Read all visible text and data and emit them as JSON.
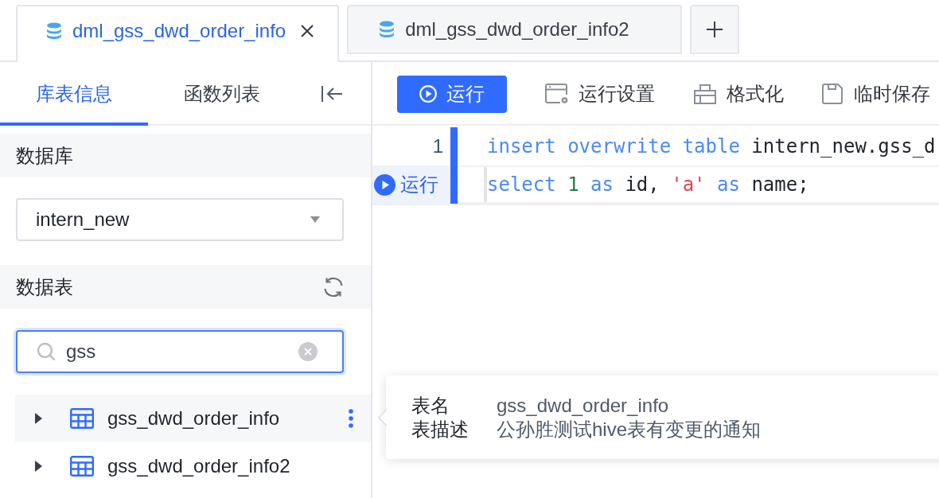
{
  "file_tabs": [
    {
      "label": "dml_gss_dwd_order_info",
      "selected": true
    },
    {
      "label": "dml_gss_dwd_order_info2",
      "selected": false
    }
  ],
  "sidebar": {
    "tabs": [
      {
        "label": "库表信息",
        "selected": true
      },
      {
        "label": "函数列表",
        "selected": false
      }
    ],
    "database": {
      "title": "数据库",
      "value": "intern_new"
    },
    "tables": {
      "title": "数据表",
      "search": {
        "value": "gss"
      },
      "items": [
        {
          "label": "gss_dwd_order_info",
          "selected": true,
          "expanded": false
        },
        {
          "label": "gss_dwd_order_info2",
          "selected": false,
          "expanded": false
        }
      ]
    }
  },
  "toolbar": {
    "buttons": [
      {
        "kind": "run",
        "label": "运行"
      },
      {
        "kind": "settings",
        "label": "运行设置"
      },
      {
        "kind": "format",
        "label": "格式化"
      },
      {
        "kind": "save",
        "label": "临时保存"
      }
    ]
  },
  "editor": {
    "lines": [
      {
        "gutter": {
          "kind": "number",
          "text": "1"
        },
        "current": false,
        "tokens": [
          {
            "kind": "keyword",
            "text": "insert overwrite table"
          },
          {
            "kind": "plain",
            "text": " intern_new.gss_d"
          }
        ]
      },
      {
        "gutter": {
          "kind": "run",
          "text": "运行"
        },
        "current": true,
        "tokens": [
          {
            "kind": "keyword",
            "text": "select "
          },
          {
            "kind": "number",
            "text": "1"
          },
          {
            "kind": "keyword",
            "text": " as"
          },
          {
            "kind": "plain",
            "text": " id, "
          },
          {
            "kind": "string",
            "text": "'a'"
          },
          {
            "kind": "keyword",
            "text": " as"
          },
          {
            "kind": "plain",
            "text": " name;"
          }
        ]
      }
    ]
  },
  "popover": {
    "fields": [
      {
        "label": "表名",
        "value": "gss_dwd_order_info"
      },
      {
        "label": "表描述",
        "value": "公孙胜测试hive表有变更的通知"
      }
    ]
  }
}
